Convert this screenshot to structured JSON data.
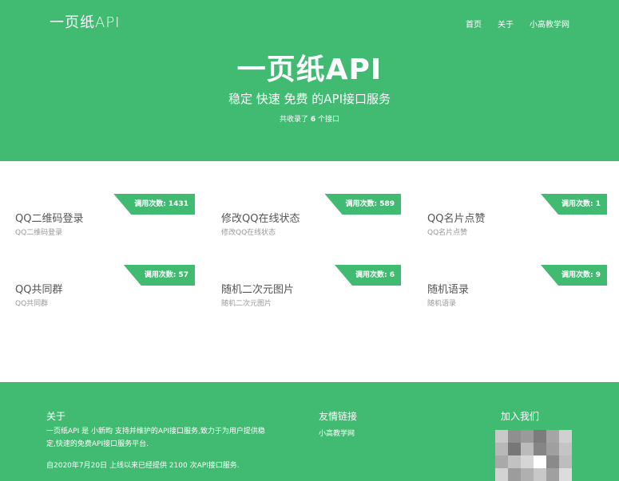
{
  "header": {
    "logo": "一页纸API",
    "nav": [
      "首页",
      "关于",
      "小高教学网"
    ]
  },
  "hero": {
    "title": "一页纸API",
    "subtitle": "稳定 快速 免费 的API接口服务",
    "count_prefix": "共收录了 ",
    "count": "6",
    "count_suffix": " 个接口"
  },
  "apis": [
    {
      "title": "QQ二维码登录",
      "desc": "QQ二维码登录",
      "badge": "调用次数: 1431"
    },
    {
      "title": "修改QQ在线状态",
      "desc": "修改QQ在线状态",
      "badge": "调用次数: 589"
    },
    {
      "title": "QQ名片点赞",
      "desc": "QQ名片点赞",
      "badge": "调用次数: 1"
    },
    {
      "title": "QQ共同群",
      "desc": "QQ共同群",
      "badge": "调用次数: 57"
    },
    {
      "title": "随机二次元图片",
      "desc": "随机二次元图片",
      "badge": "调用次数: 6"
    },
    {
      "title": "随机语录",
      "desc": "随机语录",
      "badge": "调用次数: 9"
    }
  ],
  "footer": {
    "about_heading": "关于",
    "about_line1": "一页纸API 是 小新昀 支持并维护的API接口服务,致力于为用户提供稳",
    "about_line2": "定,快速的免费API接口服务平台.",
    "about_line3": "自2020年7月20日 上线以来已经提供 2100 次API接口服务.",
    "links_heading": "友情链接",
    "link1": "小高教学网",
    "join_heading": "加入我们"
  },
  "colors": {
    "brand_green": "#41bb72"
  }
}
